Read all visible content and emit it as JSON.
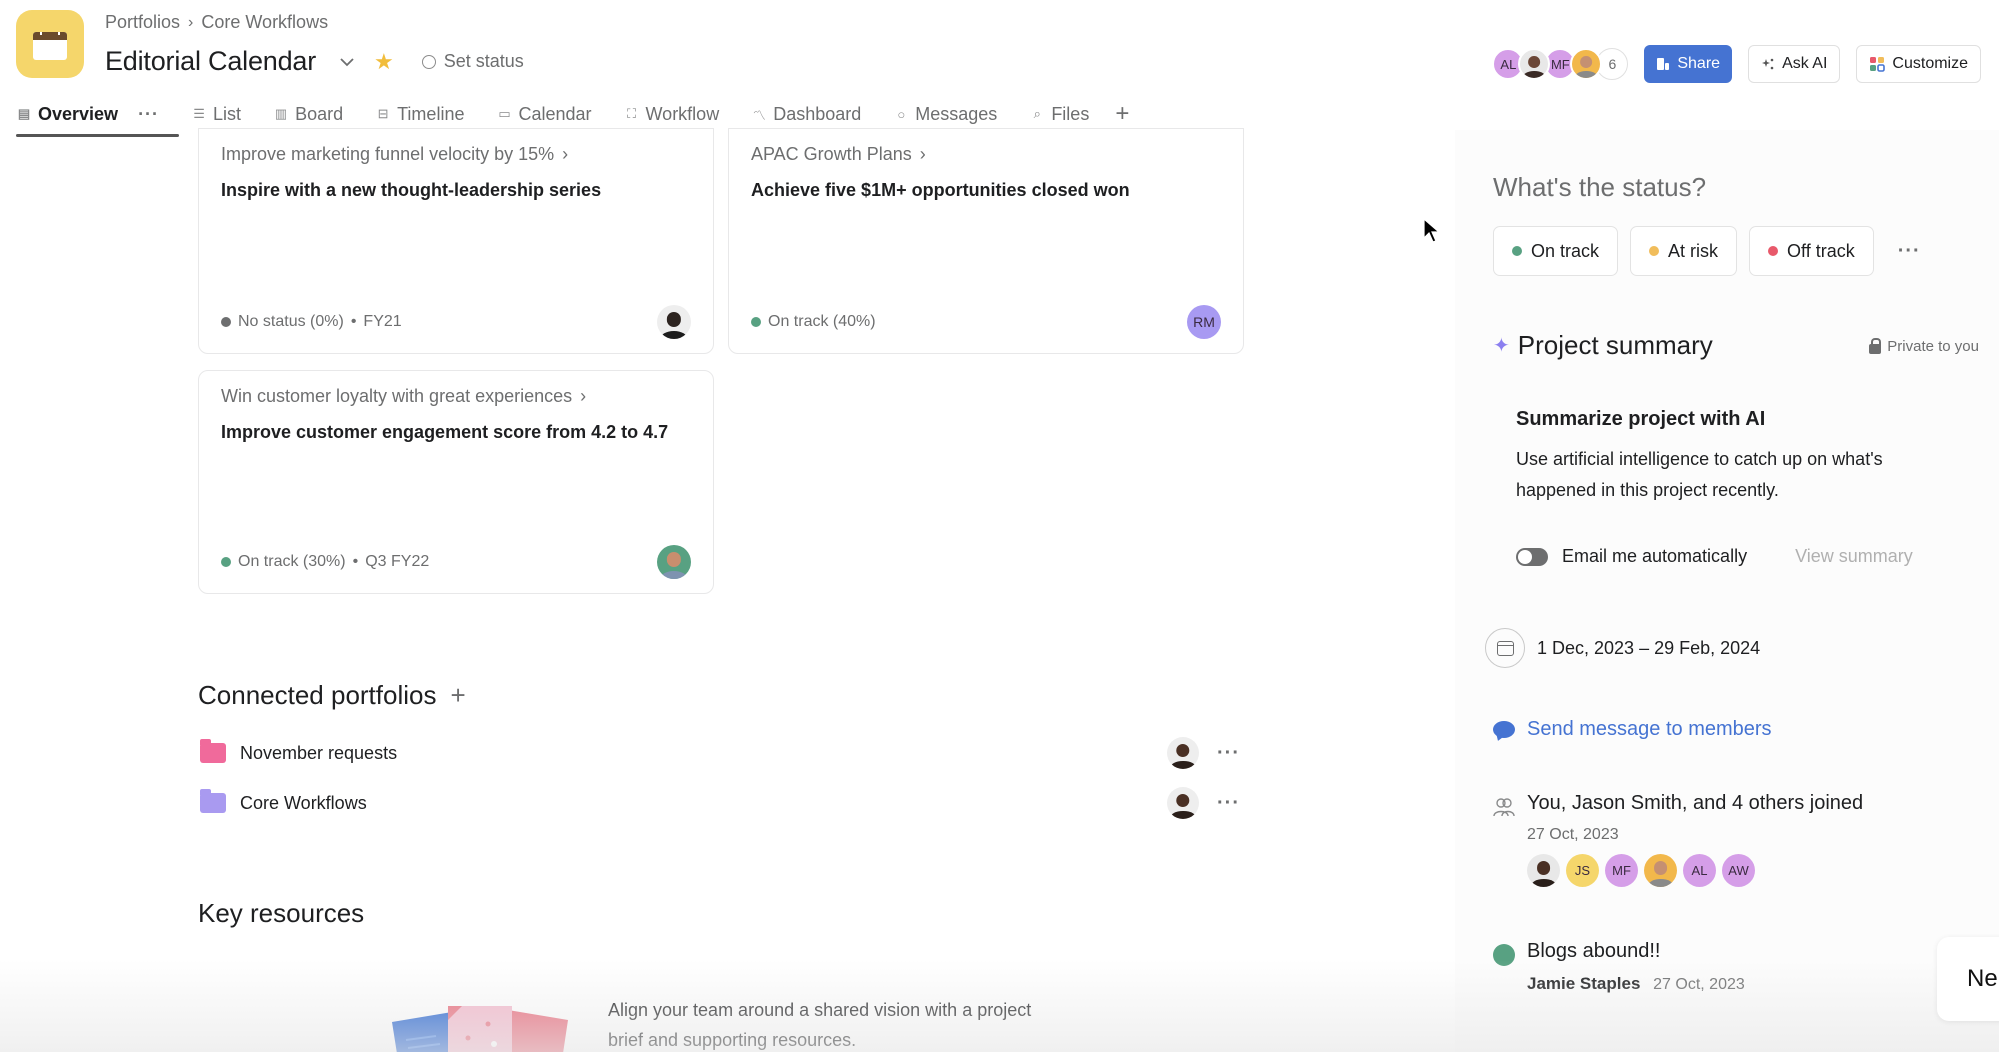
{
  "header": {
    "breadcrumb": [
      "Portfolios",
      "Core Workflows"
    ],
    "breadcrumb_separator": "›",
    "title": "Editorial Calendar",
    "set_status_label": "Set status",
    "member_avatars": [
      {
        "initials": "AL",
        "color": "#d59ee8",
        "type": "initials"
      },
      {
        "initials": "",
        "color": "#e8e8e8",
        "type": "photo"
      },
      {
        "initials": "MF",
        "color": "#d59ee8",
        "type": "initials"
      },
      {
        "initials": "",
        "color": "#f2b84b",
        "type": "photo"
      }
    ],
    "member_count": "6",
    "share_label": "Share",
    "ask_ai_label": "Ask AI",
    "customize_label": "Customize"
  },
  "tabs": [
    {
      "label": "Overview",
      "icon": "clipboard-icon",
      "active": true
    },
    {
      "label": "List",
      "icon": "list-icon"
    },
    {
      "label": "Board",
      "icon": "board-icon"
    },
    {
      "label": "Timeline",
      "icon": "timeline-icon"
    },
    {
      "label": "Calendar",
      "icon": "calendar-icon"
    },
    {
      "label": "Workflow",
      "icon": "workflow-icon"
    },
    {
      "label": "Dashboard",
      "icon": "dashboard-icon"
    },
    {
      "label": "Messages",
      "icon": "message-icon"
    },
    {
      "label": "Files",
      "icon": "paperclip-icon"
    }
  ],
  "goals": [
    {
      "parent": "Improve marketing funnel velocity by 15%",
      "title": "Inspire with a new thought-leadership series",
      "status": "No status (0%)",
      "period": "FY21",
      "status_color": "#6d6e6f",
      "owner": {
        "type": "photo",
        "initials": ""
      }
    },
    {
      "parent": "APAC Growth Plans",
      "title": "Achieve five $1M+ opportunities closed won",
      "status": "On track (40%)",
      "period": "",
      "status_color": "#58a182",
      "owner": {
        "type": "initials",
        "initials": "RM",
        "color": "#a89af2"
      }
    },
    {
      "parent": "Win customer loyalty with great experiences",
      "title": "Improve customer engagement score from 4.2 to 4.7",
      "status": "On track (30%)",
      "period": "Q3 FY22",
      "status_color": "#58a182",
      "owner": {
        "type": "photo",
        "initials": ""
      }
    }
  ],
  "connected_portfolios": {
    "title": "Connected portfolios",
    "items": [
      {
        "name": "November requests",
        "color": "#f06a9b"
      },
      {
        "name": "Core Workflows",
        "color": "#a99af0"
      }
    ]
  },
  "key_resources": {
    "title": "Key resources",
    "description": "Align your team around a shared vision with a project brief and supporting resources."
  },
  "status_panel": {
    "title": "What's the status?",
    "options": [
      {
        "label": "On track",
        "color": "#58a182"
      },
      {
        "label": "At risk",
        "color": "#f1bd5b"
      },
      {
        "label": "Off track",
        "color": "#e8596b"
      }
    ]
  },
  "project_summary": {
    "title": "Project summary",
    "privacy": "Private to you",
    "ai_title": "Summarize project with AI",
    "ai_description": "Use artificial intelligence to catch up on what's happened in this project recently.",
    "email_label": "Email me automatically",
    "email_enabled": false,
    "view_summary_label": "View summary"
  },
  "date_range": "1 Dec, 2023 – 29 Feb, 2024",
  "send_message_label": "Send message to members",
  "activity": {
    "joined": {
      "title": "You, Jason Smith, and 4 others joined",
      "date": "27 Oct, 2023",
      "avatars": [
        {
          "initials": "",
          "type": "photo",
          "color": "#e8e8e8"
        },
        {
          "initials": "JS",
          "type": "initials",
          "color": "#f5d66b"
        },
        {
          "initials": "MF",
          "type": "initials",
          "color": "#d59ee8"
        },
        {
          "initials": "",
          "type": "photo",
          "color": "#f2b84b"
        },
        {
          "initials": "AL",
          "type": "initials",
          "color": "#d59ee8"
        },
        {
          "initials": "AW",
          "type": "initials",
          "color": "#d59ee8"
        }
      ]
    },
    "status_update": {
      "title": "Blogs abound!!",
      "author": "Jamie Staples",
      "date": "27 Oct, 2023"
    }
  },
  "toast": {
    "text": "Ne"
  },
  "colors": {
    "accent": "#4573d2",
    "on_track": "#58a182",
    "at_risk": "#f1bd5b",
    "off_track": "#e8596b",
    "app_icon": "#f5d66b"
  }
}
